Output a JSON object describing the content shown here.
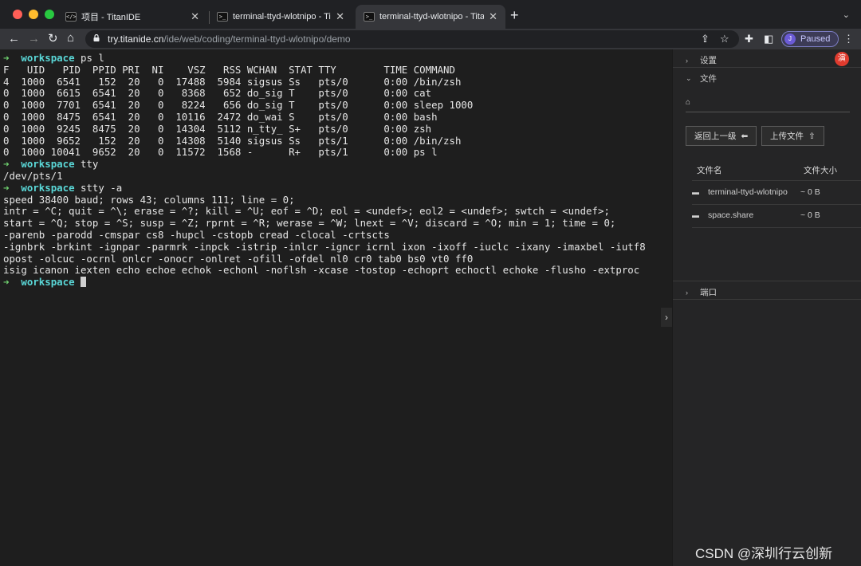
{
  "browser": {
    "tabs": [
      {
        "title": "项目 - TitanIDE",
        "active": false
      },
      {
        "title": "terminal-ttyd-wlotnipo - Titan",
        "active": false
      },
      {
        "title": "terminal-ttyd-wlotnipo - Titan",
        "active": true
      }
    ],
    "url_host": "try.titanide.cn",
    "url_path": "/ide/web/coding/terminal-ttyd-wlotnipo/demo",
    "profile_initial": "J",
    "profile_status": "Paused"
  },
  "terminal": {
    "prompt_dir": "workspace",
    "lines": [
      {
        "kind": "prompt",
        "text": "ps l"
      },
      {
        "kind": "out",
        "text": "F   UID   PID  PPID PRI  NI    VSZ   RSS WCHAN  STAT TTY        TIME COMMAND"
      },
      {
        "kind": "out",
        "text": "4  1000  6541   152  20   0  17488  5984 sigsus Ss   pts/0      0:00 /bin/zsh"
      },
      {
        "kind": "out",
        "text": "0  1000  6615  6541  20   0   8368   652 do_sig T    pts/0      0:00 cat"
      },
      {
        "kind": "out",
        "text": "0  1000  7701  6541  20   0   8224   656 do_sig T    pts/0      0:00 sleep 1000"
      },
      {
        "kind": "out",
        "text": "0  1000  8475  6541  20   0  10116  2472 do_wai S    pts/0      0:00 bash"
      },
      {
        "kind": "out",
        "text": "0  1000  9245  8475  20   0  14304  5112 n_tty_ S+   pts/0      0:00 zsh"
      },
      {
        "kind": "out",
        "text": "0  1000  9652   152  20   0  14308  5140 sigsus Ss   pts/1      0:00 /bin/zsh"
      },
      {
        "kind": "out",
        "text": "0  1000 10041  9652  20   0  11572  1568 -      R+   pts/1      0:00 ps l"
      },
      {
        "kind": "prompt",
        "text": "tty"
      },
      {
        "kind": "out",
        "text": "/dev/pts/1"
      },
      {
        "kind": "prompt",
        "text": "stty -a"
      },
      {
        "kind": "out",
        "text": "speed 38400 baud; rows 43; columns 111; line = 0;"
      },
      {
        "kind": "out",
        "text": "intr = ^C; quit = ^\\; erase = ^?; kill = ^U; eof = ^D; eol = <undef>; eol2 = <undef>; swtch = <undef>;"
      },
      {
        "kind": "out",
        "text": "start = ^Q; stop = ^S; susp = ^Z; rprnt = ^R; werase = ^W; lnext = ^V; discard = ^O; min = 1; time = 0;"
      },
      {
        "kind": "out",
        "text": "-parenb -parodd -cmspar cs8 -hupcl -cstopb cread -clocal -crtscts"
      },
      {
        "kind": "out",
        "text": "-ignbrk -brkint -ignpar -parmrk -inpck -istrip -inlcr -igncr icrnl ixon -ixoff -iuclc -ixany -imaxbel -iutf8"
      },
      {
        "kind": "out",
        "text": "opost -olcuc -ocrnl onlcr -onocr -onlret -ofill -ofdel nl0 cr0 tab0 bs0 vt0 ff0"
      },
      {
        "kind": "out",
        "text": "isig icanon iexten echo echoe echok -echonl -noflsh -xcase -tostop -echoprt echoctl echoke -flusho -extproc"
      },
      {
        "kind": "prompt",
        "text": ""
      }
    ]
  },
  "panel": {
    "settings_label": "设置",
    "files_label": "文件",
    "back_label": "返回上一级",
    "upload_label": "上传文件",
    "col_name": "文件名",
    "col_size": "文件大小",
    "files": [
      {
        "name": "terminal-ttyd-wlotnipo",
        "size": "~ 0 B"
      },
      {
        "name": "space.share",
        "size": "~ 0 B"
      }
    ],
    "ports_label": "端口",
    "badge": "演"
  },
  "watermark": "CSDN @深圳行云创新",
  "colors": {
    "prompt_arrow": "#6fd16f",
    "prompt_dir": "#5ad7d7",
    "badge": "#e03b2e",
    "paused_accent": "#7b7cc2"
  }
}
